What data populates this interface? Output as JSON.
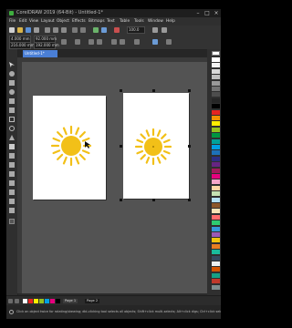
{
  "app": {
    "title": "CorelDRAW 2019 (64-Bit) - Untitled-1*",
    "menus": [
      "File",
      "Edit",
      "View",
      "Layout",
      "Object",
      "Effects",
      "Bitmaps",
      "Text",
      "Table",
      "Tools",
      "Window",
      "Help"
    ]
  },
  "properties": {
    "x": "4.000 mm",
    "y": "216.000 mm",
    "w": "92.000 mm",
    "h": "192.000 mm",
    "scale": "100.0"
  },
  "document": {
    "tab_label": "Untitled-1*"
  },
  "pages": {
    "tabs": [
      "Page 1",
      "Page 2"
    ]
  },
  "status": {
    "hint": "Click an object twice for rotating/skewing; dbl-clicking tool selects all objects; Shift+click multi-selects; Alt+click digs; Ctrl+click selects in a group"
  },
  "colors": {
    "sun": "#f2c018",
    "accent": "#4a7fd6",
    "canvas": "#535353",
    "palette": [
      "#ffffff",
      "#f2f2f2",
      "#d9d9d9",
      "#bfbfbf",
      "#999999",
      "#737373",
      "#4d4d4d",
      "#262626",
      "#000000",
      "#e52421",
      "#f39200",
      "#ffed00",
      "#95c11f",
      "#009640",
      "#00a19a",
      "#009fe3",
      "#1d71b8",
      "#2d2e83",
      "#662483",
      "#a3195b",
      "#e6007e",
      "#f5a6c9",
      "#ffd6a5",
      "#c6e2b3",
      "#b3e0f2",
      "#8b572a",
      "#f7e3b5",
      "#ff6b6b",
      "#2ecc71",
      "#3498db",
      "#9b59b6",
      "#f1c40f",
      "#e67e22",
      "#1abc9c",
      "#34495e",
      "#ecf0f1",
      "#d35400",
      "#16a085",
      "#c0392b",
      "#7f8c8d"
    ],
    "bottom_swatches": [
      "#ffffff",
      "#e52421",
      "#ffed00",
      "#95c11f",
      "#009fe3",
      "#e6007e",
      "#000000"
    ]
  }
}
